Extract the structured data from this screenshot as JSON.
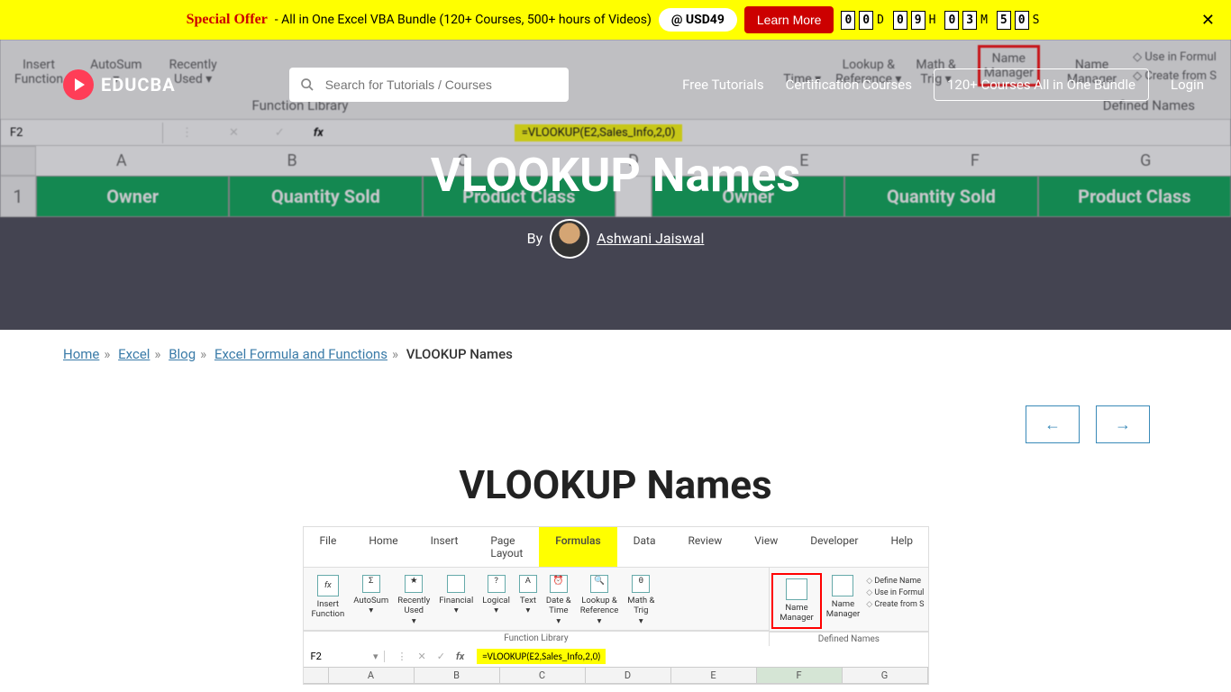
{
  "promo": {
    "special_label": "Special Offer",
    "text": " - All in One Excel VBA Bundle (120+ Courses, 500+ hours of Videos) ",
    "price": "@ USD49",
    "learn_more": "Learn More",
    "countdown": {
      "d1": "0",
      "d2": "0",
      "dl": "D",
      "h1": "0",
      "h2": "9",
      "hl": "H",
      "m1": "0",
      "m2": "3",
      "ml": "M",
      "s1": "5",
      "s2": "0",
      "sl": "S"
    }
  },
  "nav": {
    "brand": "EDUCBA",
    "search_placeholder": "Search for Tutorials / Courses",
    "links": {
      "tutorials": "Free Tutorials",
      "certification": "Certification Courses",
      "bundle": "120+ Courses All in One Bundle",
      "login": "Login"
    }
  },
  "hero": {
    "title": "VLOOKUP Names",
    "by": "By",
    "author": "Ashwani Jaiswal",
    "bg": {
      "ribbon": {
        "insert_fn": "Insert\nFunction",
        "autosum": "AutoSum",
        "recently": "Recently\nUsed",
        "lookup": "Lookup &\nReference",
        "time": "Time",
        "math": "Math &\nTrig",
        "name_mgr": "Name\nManager",
        "name_mgr2": "Name\nManager",
        "use_formula": "Use in Formul",
        "create_from": "Create from S",
        "defined": "Defined Names",
        "func_lib": "Function Library"
      },
      "cell_ref": "F2",
      "formula": "=VLOOKUP(E2,Sales_Info,2,0)",
      "cols": [
        "A",
        "B",
        "C",
        "D",
        "E",
        "F",
        "G"
      ],
      "row1": "1",
      "headers": [
        "Owner",
        "Quantity Sold",
        "Product Class",
        "",
        "Owner",
        "Quantity Sold",
        "Product Class"
      ]
    }
  },
  "breadcrumb": {
    "home": "Home",
    "excel": "Excel",
    "blog": "Blog",
    "formula": "Excel Formula and Functions",
    "current": "VLOOKUP Names"
  },
  "article": {
    "title": "VLOOKUP Names"
  },
  "excel_img": {
    "tabs": [
      "File",
      "Home",
      "Insert",
      "Page Layout",
      "Formulas",
      "Data",
      "Review",
      "View",
      "Developer",
      "Help"
    ],
    "active_tab": "Formulas",
    "ribbon": {
      "insert_fn": "Insert\nFunction",
      "autosum": "AutoSum",
      "recently": "Recently\nUsed",
      "financial": "Financial",
      "logical": "Logical",
      "text": "Text",
      "datetime": "Date &\nTime",
      "lookup": "Lookup &\nReference",
      "math": "Math &\nTrig",
      "name_mgr": "Name\nManager",
      "name_mgr2": "Name\nManager",
      "define_name": "Define Name",
      "use_formula": "Use in Formul",
      "create_from": "Create from S",
      "func_lib": "Function Library",
      "defined": "Defined Names"
    },
    "cell_ref": "F2",
    "formula": "=VLOOKUP(E2,Sales_Info,2,0)",
    "cols": [
      "A",
      "B",
      "C",
      "D",
      "E",
      "F",
      "G"
    ],
    "selected_col": "F"
  }
}
